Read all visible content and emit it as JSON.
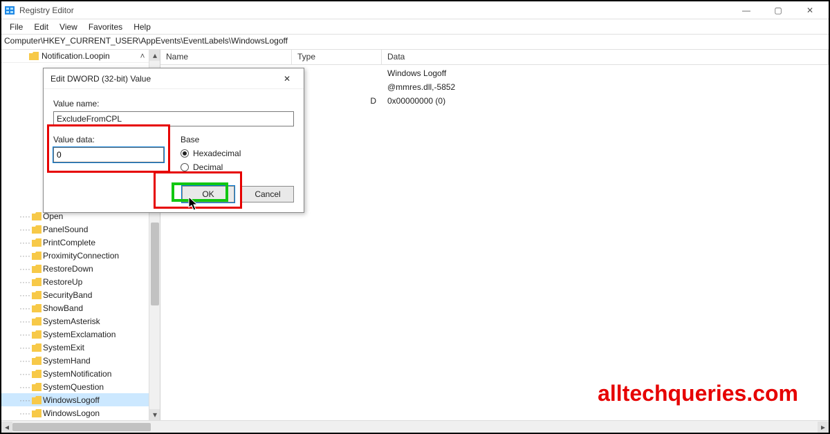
{
  "window": {
    "title": "Registry Editor",
    "controls": {
      "minimize": "—",
      "maximize": "▢",
      "close": "✕"
    }
  },
  "menu": [
    "File",
    "Edit",
    "View",
    "Favorites",
    "Help"
  ],
  "address": "Computer\\HKEY_CURRENT_USER\\AppEvents\\EventLabels\\WindowsLogoff",
  "tree": {
    "top_item": "Notification.Loopin",
    "items": [
      "Open",
      "PanelSound",
      "PrintComplete",
      "ProximityConnection",
      "RestoreDown",
      "RestoreUp",
      "SecurityBand",
      "ShowBand",
      "SystemAsterisk",
      "SystemExclamation",
      "SystemExit",
      "SystemHand",
      "SystemNotification",
      "SystemQuestion",
      "WindowsLogoff",
      "WindowsLogon"
    ],
    "selected": "WindowsLogoff"
  },
  "list": {
    "headers": {
      "name": "Name",
      "type": "Type",
      "data": "Data"
    },
    "rows": [
      {
        "name": "",
        "type": "",
        "data": "Windows Logoff"
      },
      {
        "name": "",
        "type": "",
        "data": "@mmres.dll,-5852"
      },
      {
        "name": "",
        "type_suffix": "D",
        "data": "0x00000000 (0)"
      }
    ]
  },
  "dialog": {
    "title": "Edit DWORD (32-bit) Value",
    "close": "✕",
    "value_name_label": "Value name:",
    "value_name": "ExcludeFromCPL",
    "value_data_label": "Value data:",
    "value_data": "0",
    "base_label": "Base",
    "radios": {
      "hex": "Hexadecimal",
      "dec": "Decimal",
      "selected": "hex"
    },
    "buttons": {
      "ok": "OK",
      "cancel": "Cancel"
    }
  },
  "watermark": "alltechqueries.com"
}
